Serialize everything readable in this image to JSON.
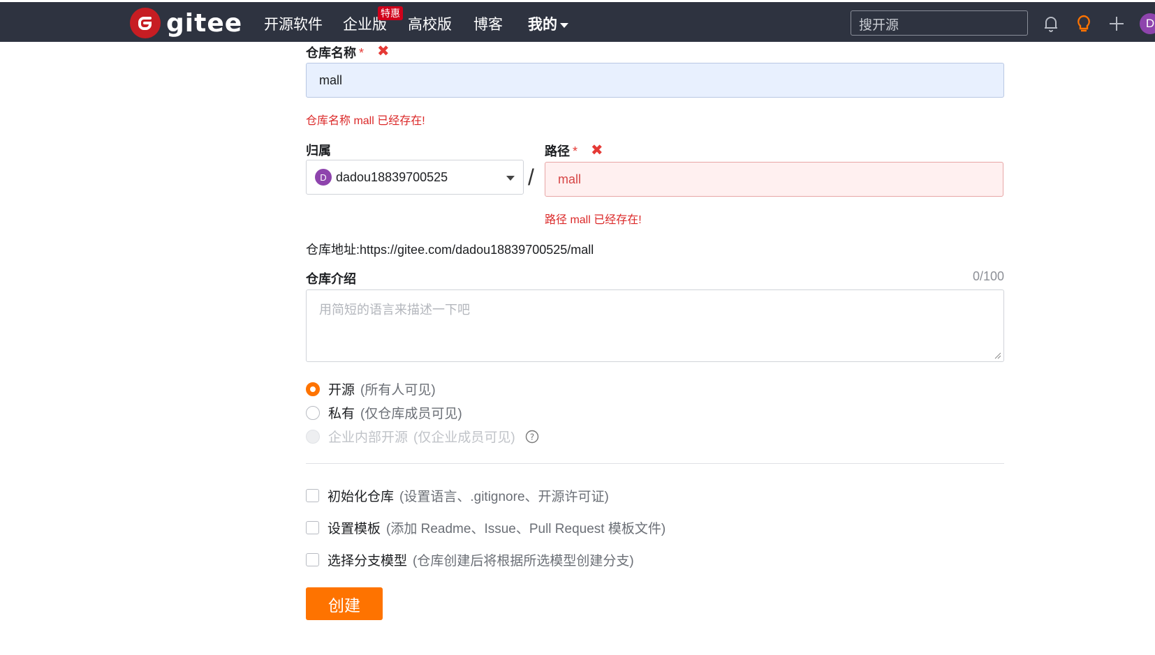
{
  "colors": {
    "navbar": "#2e3340",
    "brand_red": "#c71d23",
    "accent_orange": "#fe7300",
    "error_red": "#db2828",
    "repo_input_bg": "#e8f0fe",
    "path_input_bg": "#fff0f0"
  },
  "navbar": {
    "logo_text": "gitee",
    "logo_icon": "gitee-logo-icon",
    "links": [
      "开源软件",
      "企业版",
      "高校版",
      "博客",
      "我的"
    ],
    "badge": "特惠",
    "search_placeholder": "搜开源",
    "icons": [
      "bell-icon",
      "lightbulb-icon",
      "plus-icon"
    ],
    "avatar": "D"
  },
  "form": {
    "repo_name_label": "仓库名称",
    "required_mark": "*",
    "repo_name_value": "mall",
    "repo_name_error": "仓库名称 mall 已经存在!",
    "owner_label": "归属",
    "owner_avatar": "D",
    "owner_value": "dadou18839700525",
    "separator": "/",
    "path_label": "路径",
    "path_value": "mall",
    "path_error": "路径 mall 已经存在!",
    "address_label": "仓库地址:",
    "address_value": "https://gitee.com/dadou18839700525/mall",
    "intro_label": "仓库介绍",
    "intro_counter": "0/100",
    "intro_placeholder": "用简短的语言来描述一下吧",
    "visibility": [
      {
        "label": "开源",
        "hint": "(所有人可见)",
        "state": "selected"
      },
      {
        "label": "私有",
        "hint": "(仅仓库成员可见)",
        "state": "unselected"
      },
      {
        "label": "企业内部开源",
        "hint": "(仅企业成员可见)",
        "state": "disabled"
      }
    ],
    "options": [
      {
        "label": "初始化仓库",
        "hint": "(设置语言、.gitignore、开源许可证)",
        "checked": false
      },
      {
        "label": "设置模板",
        "hint": "(添加 Readme、Issue、Pull Request 模板文件)",
        "checked": false
      },
      {
        "label": "选择分支模型",
        "hint": "(仓库创建后将根据所选模型创建分支)",
        "checked": false
      }
    ],
    "submit_label": "创建"
  }
}
